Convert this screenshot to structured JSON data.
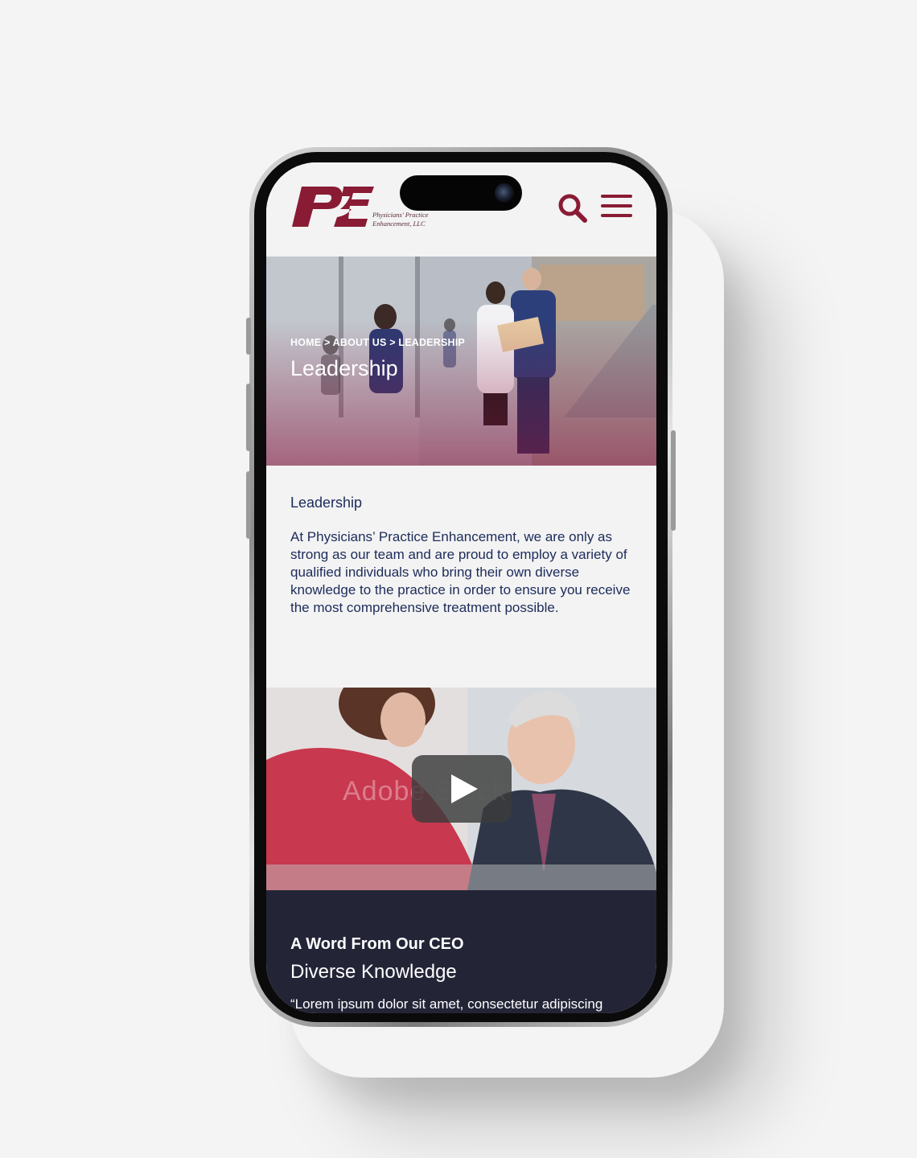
{
  "header": {
    "logo_text_line1": "Physicians' Practice",
    "logo_text_line2": "Enhancement, LLC"
  },
  "hero": {
    "breadcrumb": "HOME > ABOUT US > LEADERSHIP",
    "title": "Leadership"
  },
  "intro": {
    "heading": "Leadership",
    "body": "At Physicians’ Practice Enhancement, we are only as strong as our team and are proud to employ a variety of qualified individuals who bring their own diverse knowledge to the practice in order to ensure you receive the most comprehensive treatment possible."
  },
  "video": {
    "watermark": "Adobe Stock"
  },
  "ceo": {
    "heading": "A Word From Our CEO",
    "subheading": "Diverse Knowledge",
    "quote": "“Lorem ipsum dolor sit amet, consectetur adipiscing"
  },
  "icons": {
    "search": "search-icon",
    "menu": "hamburger-menu-icon",
    "play": "play-icon"
  },
  "colors": {
    "brand": "#8a1b34",
    "text_navy": "#1c2b5a",
    "footer_bg": "#232537"
  }
}
